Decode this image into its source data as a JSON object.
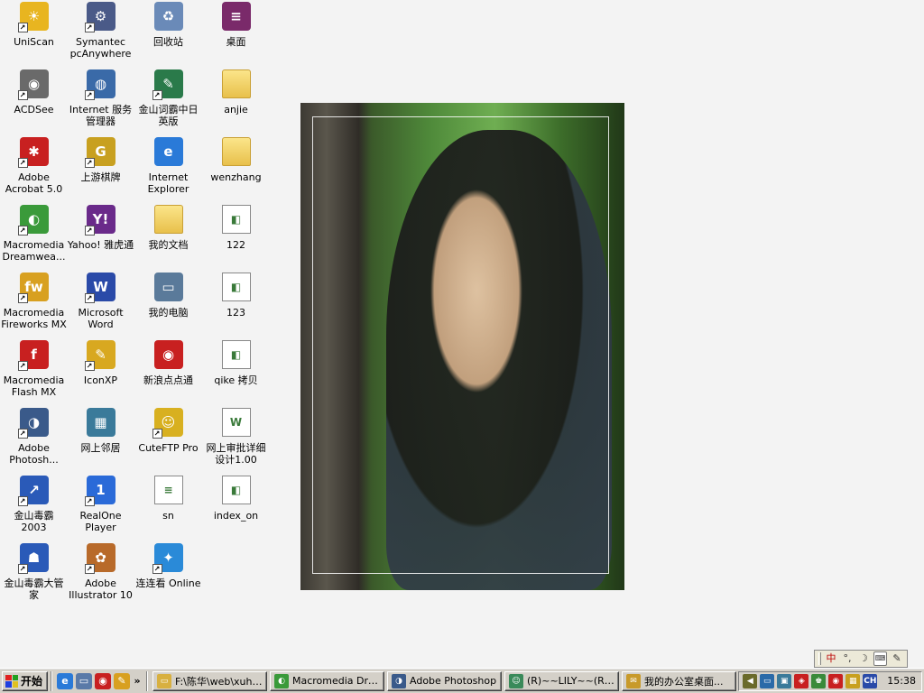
{
  "desktop": {
    "icons": [
      {
        "label": "UniScan",
        "icon": "uniscan-icon",
        "glyph": "☀",
        "color": "#e8b520",
        "shortcut": true
      },
      {
        "label": "Symantec pcAnywhere",
        "icon": "pcanywhere-icon",
        "glyph": "⚙",
        "color": "#4a5a88",
        "shortcut": true
      },
      {
        "label": "回收站",
        "icon": "recycle-bin-icon",
        "glyph": "♻",
        "color": "#6a8ab8",
        "shortcut": false
      },
      {
        "label": "桌面",
        "icon": "archive-icon",
        "glyph": "≡",
        "color": "#7a2a6a",
        "shortcut": false
      },
      {
        "label": "ACDSee",
        "icon": "acdsee-icon",
        "glyph": "◉",
        "color": "#6a6a6a",
        "shortcut": true
      },
      {
        "label": "Internet 服务管理器",
        "icon": "iis-manager-icon",
        "glyph": "◍",
        "color": "#3a6aa8",
        "shortcut": true
      },
      {
        "label": "金山词霸中日英版",
        "icon": "kingsoft-dictionary-icon",
        "glyph": "✎",
        "color": "#2a7a4a",
        "shortcut": true
      },
      {
        "label": "anjie",
        "icon": "folder-icon",
        "glyph": "",
        "color": "folder",
        "shortcut": false
      },
      {
        "label": "Adobe Acrobat 5.0",
        "icon": "acrobat-icon",
        "glyph": "✱",
        "color": "#c82020",
        "shortcut": true
      },
      {
        "label": "上游棋牌",
        "icon": "chess-game-icon",
        "glyph": "G",
        "color": "#c8a020",
        "shortcut": true
      },
      {
        "label": "Internet Explorer",
        "icon": "internet-explorer-icon",
        "glyph": "e",
        "color": "#2a7ad8",
        "shortcut": false
      },
      {
        "label": "wenzhang",
        "icon": "folder-icon",
        "glyph": "",
        "color": "folder",
        "shortcut": false
      },
      {
        "label": "Macromedia Dreamwea...",
        "icon": "dreamweaver-icon",
        "glyph": "◐",
        "color": "#3a9a3a",
        "shortcut": true
      },
      {
        "label": "Yahoo! 雅虎通",
        "icon": "yahoo-messenger-icon",
        "glyph": "Y!",
        "color": "#6a2a8a",
        "shortcut": true
      },
      {
        "label": "我的文档",
        "icon": "my-documents-icon",
        "glyph": "",
        "color": "folder",
        "shortcut": false
      },
      {
        "label": "122",
        "icon": "image-file-icon",
        "glyph": "◧",
        "color": "doc",
        "shortcut": false
      },
      {
        "label": "Macromedia Fireworks MX",
        "icon": "fireworks-icon",
        "glyph": "fw",
        "color": "#d8a020",
        "shortcut": true
      },
      {
        "label": "Microsoft Word",
        "icon": "word-icon",
        "glyph": "W",
        "color": "#2a4aa8",
        "shortcut": true
      },
      {
        "label": "我的电脑",
        "icon": "my-computer-icon",
        "glyph": "▭",
        "color": "#5a7a9a",
        "shortcut": false
      },
      {
        "label": "123",
        "icon": "image-file-icon",
        "glyph": "◧",
        "color": "doc",
        "shortcut": false
      },
      {
        "label": "Macromedia Flash MX",
        "icon": "flash-icon",
        "glyph": "f",
        "color": "#c82020",
        "shortcut": true
      },
      {
        "label": "IconXP",
        "icon": "iconxp-icon",
        "glyph": "✎",
        "color": "#d8a820",
        "shortcut": true
      },
      {
        "label": "新浪点点通",
        "icon": "sina-icon",
        "glyph": "◉",
        "color": "#c82020",
        "shortcut": false
      },
      {
        "label": "qike 拷贝",
        "icon": "image-file-icon",
        "glyph": "◧",
        "color": "doc",
        "shortcut": false
      },
      {
        "label": "Adobe Photosh...",
        "icon": "photoshop-icon",
        "glyph": "◑",
        "color": "#3a5a8a",
        "shortcut": true
      },
      {
        "label": "网上邻居",
        "icon": "network-places-icon",
        "glyph": "▦",
        "color": "#3a7a9a",
        "shortcut": false
      },
      {
        "label": "CuteFTP Pro",
        "icon": "cuteftp-icon",
        "glyph": "☺",
        "color": "#d8b020",
        "shortcut": true
      },
      {
        "label": "网上审批详细设计1.00",
        "icon": "word-document-icon",
        "glyph": "W",
        "color": "doc",
        "shortcut": false
      },
      {
        "label": "金山毒霸 2003",
        "icon": "kingsoft-antivirus-icon",
        "glyph": "↗",
        "color": "#2a5ab8",
        "shortcut": true
      },
      {
        "label": "RealOne Player",
        "icon": "realone-icon",
        "glyph": "1",
        "color": "#2a6ad8",
        "shortcut": true
      },
      {
        "label": "sn",
        "icon": "text-file-icon",
        "glyph": "≡",
        "color": "doc",
        "shortcut": false
      },
      {
        "label": "index_on",
        "icon": "image-file-icon",
        "glyph": "◧",
        "color": "doc",
        "shortcut": false
      },
      {
        "label": "金山毒霸大管家",
        "icon": "antivirus-manager-icon",
        "glyph": "☗",
        "color": "#2a5ab8",
        "shortcut": true
      },
      {
        "label": "Adobe Illustrator 10",
        "icon": "illustrator-icon",
        "glyph": "✿",
        "color": "#b86a2a",
        "shortcut": true
      },
      {
        "label": "连连看 Online",
        "icon": "lianliankan-icon",
        "glyph": "✦",
        "color": "#2a8ad8",
        "shortcut": true
      }
    ]
  },
  "language_bar": {
    "items": [
      {
        "label": "中",
        "icon": "chinese-input-icon"
      },
      {
        "label": "°,",
        "icon": "punctuation-icon"
      },
      {
        "label": "☽",
        "icon": "half-width-icon"
      },
      {
        "label": "⌨",
        "icon": "soft-keyboard-icon"
      },
      {
        "label": "✎",
        "icon": "ime-menu-icon"
      }
    ]
  },
  "taskbar": {
    "start_label": "开始",
    "quick_launch": [
      {
        "icon": "ie-quicklaunch-icon",
        "glyph": "e",
        "color": "#2a7ad8"
      },
      {
        "icon": "show-desktop-icon",
        "glyph": "▭",
        "color": "#5a7aa8"
      },
      {
        "icon": "sina-quicklaunch-icon",
        "glyph": "◉",
        "color": "#c82020"
      },
      {
        "icon": "pencil-quicklaunch-icon",
        "glyph": "✎",
        "color": "#d8a020"
      }
    ],
    "quick_launch_more": "»",
    "buttons": [
      {
        "label": "F:\\陈华\\web\\xuhu...",
        "icon": "explorer-folder-icon",
        "glyph": "▭",
        "color": "#d8b040",
        "active": false
      },
      {
        "label": "Macromedia Dream...",
        "icon": "dreamweaver-icon",
        "glyph": "◐",
        "color": "#3a9a3a",
        "active": false
      },
      {
        "label": "Adobe Photoshop",
        "icon": "photoshop-icon",
        "glyph": "◑",
        "color": "#3a5a8a",
        "active": false
      },
      {
        "label": "(R)~~LILY~~(R)...",
        "icon": "chat-icon",
        "glyph": "☺",
        "color": "#3a8a5a",
        "active": false
      },
      {
        "label": "我的办公室桌面...",
        "icon": "mail-icon",
        "glyph": "✉",
        "color": "#c89a2a",
        "active": false
      }
    ],
    "tray": [
      {
        "icon": "volume-icon",
        "glyph": "◀",
        "color": "#6a6a2a"
      },
      {
        "icon": "network-tray-icon",
        "glyph": "▭",
        "color": "#2a6aa8"
      },
      {
        "icon": "monitor-tray-icon",
        "glyph": "▣",
        "color": "#3a7a9a"
      },
      {
        "icon": "antivirus-tray-icon",
        "glyph": "◈",
        "color": "#c82020"
      },
      {
        "icon": "shield-tray-icon",
        "glyph": "♚",
        "color": "#3a8a3a"
      },
      {
        "icon": "sina-tray-icon",
        "glyph": "◉",
        "color": "#c82020"
      },
      {
        "icon": "folder-tray-icon",
        "glyph": "▦",
        "color": "#c8a020"
      },
      {
        "icon": "ime-tray-icon",
        "glyph": "CH",
        "color": "#2a4aa8"
      }
    ],
    "clock": "15:38"
  }
}
